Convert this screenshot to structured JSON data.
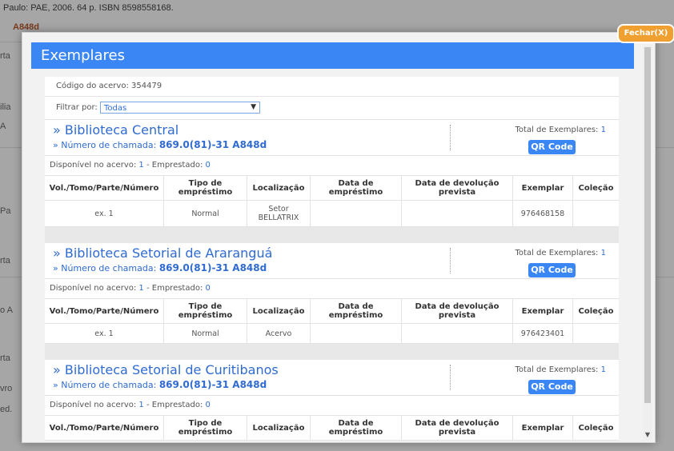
{
  "background": {
    "top_text": "Paulo: PAE, 2006. 64 p. ISBN 8598558168.",
    "call_fragment": "A848d",
    "fragments": [
      {
        "text": "rta"
      },
      {
        "text": "ilia"
      },
      {
        "text": "A"
      },
      {
        "text": "Pa"
      },
      {
        "text": "rta"
      },
      {
        "text": "o A"
      },
      {
        "text": "rta"
      },
      {
        "text": "vro"
      },
      {
        "text": "ed."
      }
    ]
  },
  "modal": {
    "title": "Exemplares",
    "close_label": "Fechar(X)",
    "acervo_code_label": "Código do acervo: 354479",
    "filter_label": "Filtrar por:",
    "filter_value": "Todas"
  },
  "table_headers": {
    "vol": "Vol./Tomo/Parte/Número",
    "tipo": "Tipo de empréstimo",
    "localizacao": "Localização",
    "data_emprestimo": "Data de empréstimo",
    "data_devolucao": "Data de devolução prevista",
    "exemplar": "Exemplar",
    "colecao": "Coleção"
  },
  "libraries": [
    {
      "name": "» Biblioteca Central",
      "call_label": "» Número de chamada:",
      "call_number": "869.0(81)-31 A848d",
      "total_label": "Total de Exemplares:",
      "total": "1",
      "qr_label": "QR Code",
      "available_label": "Disponível no acervo:",
      "available": "1",
      "loaned_label": "- Emprestado:",
      "loaned": "0",
      "rows": [
        {
          "vol": "ex. 1",
          "tipo": "Normal",
          "localizacao": "Setor BELLATRIX",
          "data_emprestimo": "",
          "data_devolucao": "",
          "exemplar": "976468158",
          "colecao": ""
        }
      ]
    },
    {
      "name": "» Biblioteca Setorial de Araranguá",
      "call_label": "» Número de chamada:",
      "call_number": "869.0(81)-31 A848d",
      "total_label": "Total de Exemplares:",
      "total": "1",
      "qr_label": "QR Code",
      "available_label": "Disponível no acervo:",
      "available": "1",
      "loaned_label": "- Emprestado:",
      "loaned": "0",
      "rows": [
        {
          "vol": "ex. 1",
          "tipo": "Normal",
          "localizacao": "Acervo",
          "data_emprestimo": "",
          "data_devolucao": "",
          "exemplar": "976423401",
          "colecao": ""
        }
      ]
    },
    {
      "name": "» Biblioteca Setorial de Curitibanos",
      "call_label": "» Número de chamada:",
      "call_number": "869.0(81)-31 A848d",
      "total_label": "Total de Exemplares:",
      "total": "1",
      "qr_label": "QR Code",
      "available_label": "Disponível no acervo:",
      "available": "1",
      "loaned_label": "- Emprestado:",
      "loaned": "0",
      "rows": []
    }
  ],
  "colors": {
    "header_blue": "#3a86f5",
    "link_blue": "#2f6bd0",
    "close_orange": "#f0a030"
  }
}
